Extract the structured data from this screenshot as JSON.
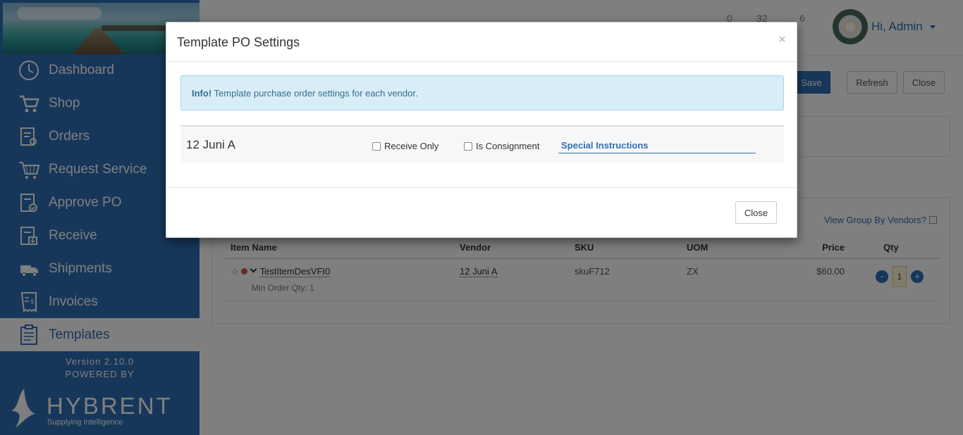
{
  "sidebar": {
    "items": [
      {
        "label": "Dashboard",
        "icon": "dashboard-icon"
      },
      {
        "label": "Shop",
        "icon": "cart-icon"
      },
      {
        "label": "Orders",
        "icon": "orders-icon"
      },
      {
        "label": "Request Service",
        "icon": "request-service-icon"
      },
      {
        "label": "Approve PO",
        "icon": "approve-po-icon"
      },
      {
        "label": "Receive",
        "icon": "receive-icon"
      },
      {
        "label": "Shipments",
        "icon": "truck-icon"
      },
      {
        "label": "Invoices",
        "icon": "invoice-icon"
      },
      {
        "label": "Templates",
        "icon": "templates-icon"
      }
    ],
    "active": "Templates",
    "version": "Version 2.10.0",
    "powered_by": "POWERED BY",
    "brand": "HYBRENT",
    "tagline": "Supplying Intelligence"
  },
  "header": {
    "counter1": "0",
    "counter2": "32",
    "counter3": "6",
    "user_greeting": "Hi, Admin"
  },
  "toolbar": {
    "save_label": "Save",
    "refresh_label": "Refresh",
    "close_label": "Close"
  },
  "items_panel": {
    "view_group_label": "View Group By Vendors?",
    "columns": [
      "Item Name",
      "Vendor",
      "SKU",
      "UOM",
      "Price",
      "Qty"
    ],
    "rows": [
      {
        "name": "TestItemDesVFI0",
        "vendor": "12 Juni A",
        "sku": "skuF712",
        "uom": "ZX",
        "price": "$60.00",
        "qty": "1",
        "min_order": "Min Order Qty: 1"
      }
    ],
    "qty_minus": "-",
    "qty_plus": "+"
  },
  "modal": {
    "title": "Template PO Settings",
    "close_x": "×",
    "alert_strong": "Info!",
    "alert_text": " Template purchase order settings for each vendor.",
    "vendor_name": "12 Juni A",
    "receive_only_label": "Receive Only",
    "consignment_label": "Is Consignment",
    "special_instructions_label": "Special Instructions",
    "close_button": "Close"
  },
  "colors": {
    "brand_blue": "#2f6fb5",
    "alert_bg": "#d9edf7",
    "alert_text": "#31708f"
  }
}
